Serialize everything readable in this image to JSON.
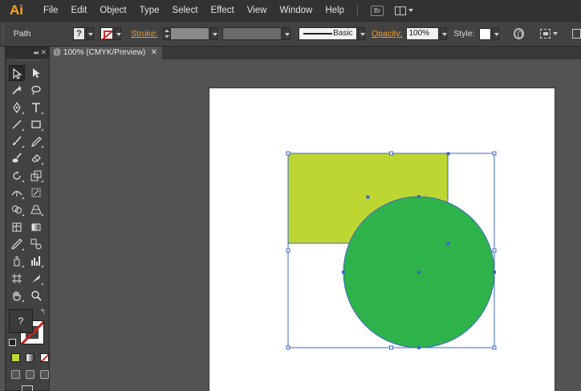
{
  "menubar": {
    "app_logo": "Ai",
    "items": [
      "File",
      "Edit",
      "Object",
      "Type",
      "Select",
      "Effect",
      "View",
      "Window",
      "Help"
    ],
    "bridge_label": "Br"
  },
  "controlbar": {
    "selection_label": "Path",
    "fill_swatch_glyph": "?",
    "stroke_label": "Stroke:",
    "brush_label": "Basic",
    "opacity_label": "Opacity:",
    "opacity_value": "100%",
    "style_label": "Style:"
  },
  "toolpanel": {
    "collapse_glyph": "◂◂",
    "close_glyph": "✕",
    "fill_glyph": "?",
    "swap_glyph": "↰",
    "active_fill_color": "#c0d834"
  },
  "document": {
    "tab_title": "@ 100% (CMYK/Preview)",
    "close_glyph": "✕"
  },
  "artwork": {
    "rectangle_color": "#bdd632",
    "circle_color": "#2eb34a",
    "selection_color": "#3c67c8"
  }
}
